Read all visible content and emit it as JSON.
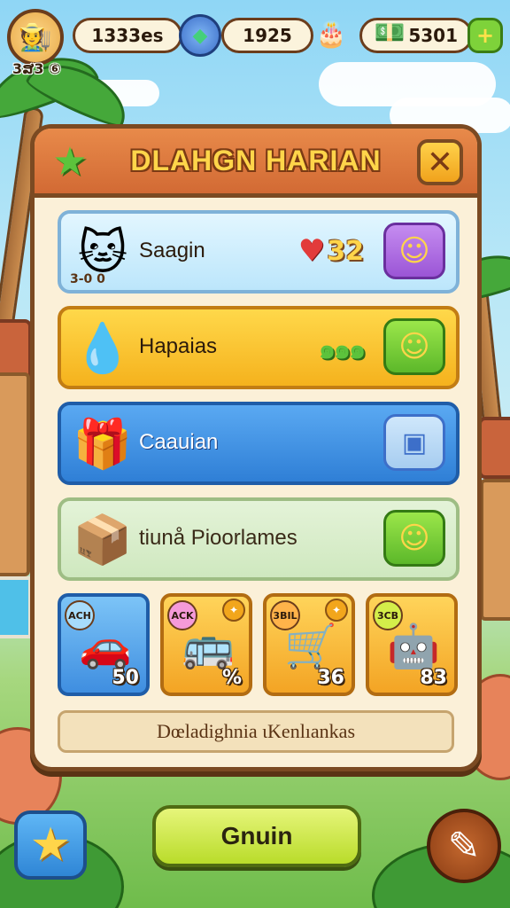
{
  "topbar": {
    "avatar_icon": "player-avatar",
    "avatar_level": "3ສ3 ⑥",
    "resource_1": "1333es",
    "resource_2": "1925",
    "resource_3": "5301",
    "gem_icon": "green-gem-icon",
    "cake_icon": "cake-icon",
    "cash_icon": "cash-stack-icon",
    "plus_icon": "plus-icon"
  },
  "panel": {
    "title": "DLAHGN HARIAN",
    "star_icon": "star-icon",
    "close_icon": "close-icon"
  },
  "quests": [
    {
      "label": "Saagin",
      "badge": "3-0 0",
      "reward": "32",
      "reward_icon": "heart-icon",
      "button_icon": "smiley-icon",
      "button_color": "#9b55d6"
    },
    {
      "label": "Hapaias",
      "reward": "๑๑๑",
      "reward_icon": "cash-icon",
      "button_icon": "smiley-icon",
      "button_color": "#5cb82a"
    },
    {
      "label": "Caauian",
      "button_icon": "box-icon",
      "button_color": "#a7cdf0"
    },
    {
      "label": "tiunå Pioorlames",
      "button_icon": "smiley-icon",
      "button_color": "#5cb82a"
    }
  ],
  "items": [
    {
      "tag": "ACH",
      "value": "50",
      "icon": "toy-car-icon"
    },
    {
      "tag": "ACK",
      "value": "%",
      "icon": "toy-bus-icon"
    },
    {
      "tag": "3BIL",
      "value": "36",
      "icon": "gold-cart-icon"
    },
    {
      "tag": "3CB",
      "value": "83",
      "icon": "purple-robot-icon"
    }
  ],
  "footer_text": "Dœladighnia ιKenlıankas",
  "bottom": {
    "main_button": "Gnuin",
    "left_icon": "star-icon",
    "right_icon": "pencil-icon"
  },
  "colors": {
    "panel_border": "#7b4a22",
    "header": "#d26a34",
    "title": "#ffd54a"
  }
}
